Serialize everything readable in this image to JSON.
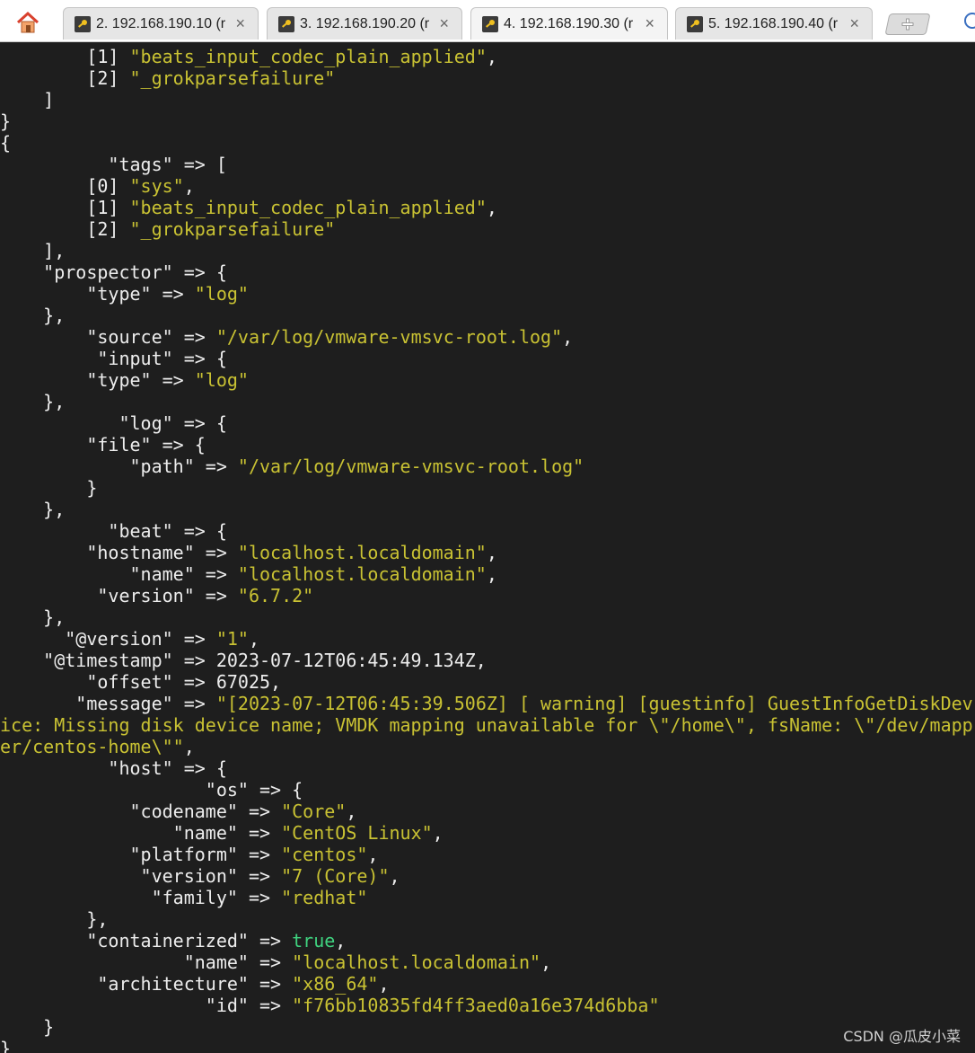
{
  "tabs": [
    {
      "label": "2. 192.168.190.10 (r",
      "active": false
    },
    {
      "label": "3. 192.168.190.20 (r",
      "active": false
    },
    {
      "label": "4. 192.168.190.30 (r",
      "active": true
    },
    {
      "label": "5. 192.168.190.40 (r",
      "active": false
    }
  ],
  "icons": {
    "home": "home-icon",
    "tab": "key-icon",
    "close": "close-icon",
    "new_tab": "new-tab-icon"
  },
  "colors": {
    "background": "#1e1e1e",
    "text": "#ededed",
    "string": "#c9c233",
    "boolean": "#3fd27f"
  },
  "terminal_lines": [
    [
      {
        "t": "        [1] "
      },
      {
        "t": "\"beats_input_codec_plain_applied\"",
        "c": "s"
      },
      {
        "t": ","
      }
    ],
    [
      {
        "t": "        [2] "
      },
      {
        "t": "\"_grokparsefailure\"",
        "c": "s"
      }
    ],
    [
      {
        "t": "    ]"
      }
    ],
    [
      {
        "t": "}"
      }
    ],
    [
      {
        "t": "{"
      }
    ],
    [
      {
        "t": "          \"tags\" => ["
      }
    ],
    [
      {
        "t": "        [0] "
      },
      {
        "t": "\"sys\"",
        "c": "s"
      },
      {
        "t": ","
      }
    ],
    [
      {
        "t": "        [1] "
      },
      {
        "t": "\"beats_input_codec_plain_applied\"",
        "c": "s"
      },
      {
        "t": ","
      }
    ],
    [
      {
        "t": "        [2] "
      },
      {
        "t": "\"_grokparsefailure\"",
        "c": "s"
      }
    ],
    [
      {
        "t": "    ],"
      }
    ],
    [
      {
        "t": "    \"prospector\" => {"
      }
    ],
    [
      {
        "t": "        \"type\" => "
      },
      {
        "t": "\"log\"",
        "c": "s"
      }
    ],
    [
      {
        "t": "    },"
      }
    ],
    [
      {
        "t": "        \"source\" => "
      },
      {
        "t": "\"/var/log/vmware-vmsvc-root.log\"",
        "c": "s"
      },
      {
        "t": ","
      }
    ],
    [
      {
        "t": "         \"input\" => {"
      }
    ],
    [
      {
        "t": "        \"type\" => "
      },
      {
        "t": "\"log\"",
        "c": "s"
      }
    ],
    [
      {
        "t": "    },"
      }
    ],
    [
      {
        "t": "           \"log\" => {"
      }
    ],
    [
      {
        "t": "        \"file\" => {"
      }
    ],
    [
      {
        "t": "            \"path\" => "
      },
      {
        "t": "\"/var/log/vmware-vmsvc-root.log\"",
        "c": "s"
      }
    ],
    [
      {
        "t": "        }"
      }
    ],
    [
      {
        "t": "    },"
      }
    ],
    [
      {
        "t": "          \"beat\" => {"
      }
    ],
    [
      {
        "t": "        \"hostname\" => "
      },
      {
        "t": "\"localhost.localdomain\"",
        "c": "s"
      },
      {
        "t": ","
      }
    ],
    [
      {
        "t": "            \"name\" => "
      },
      {
        "t": "\"localhost.localdomain\"",
        "c": "s"
      },
      {
        "t": ","
      }
    ],
    [
      {
        "t": "         \"version\" => "
      },
      {
        "t": "\"6.7.2\"",
        "c": "s"
      }
    ],
    [
      {
        "t": "    },"
      }
    ],
    [
      {
        "t": "      \"@version\" => "
      },
      {
        "t": "\"1\"",
        "c": "s"
      },
      {
        "t": ","
      }
    ],
    [
      {
        "t": "    \"@timestamp\" => 2023-07-12T06:45:49.134Z,"
      }
    ],
    [
      {
        "t": "        \"offset\" => 67025,"
      }
    ],
    [
      {
        "t": "       \"message\" => "
      },
      {
        "t": "\"[2023-07-12T06:45:39.506Z] [ warning] [guestinfo] GuestInfoGetDiskDev",
        "c": "s"
      }
    ],
    [
      {
        "t": "ice: Missing disk device name; VMDK mapping unavailable for \\\"/home\\\", fsName: \\\"/dev/mapp",
        "c": "s"
      }
    ],
    [
      {
        "t": "er/centos-home\\\"\"",
        "c": "s"
      },
      {
        "t": ","
      }
    ],
    [
      {
        "t": "          \"host\" => {"
      }
    ],
    [
      {
        "t": "                   \"os\" => {"
      }
    ],
    [
      {
        "t": "            \"codename\" => "
      },
      {
        "t": "\"Core\"",
        "c": "s"
      },
      {
        "t": ","
      }
    ],
    [
      {
        "t": "                \"name\" => "
      },
      {
        "t": "\"CentOS Linux\"",
        "c": "s"
      },
      {
        "t": ","
      }
    ],
    [
      {
        "t": "            \"platform\" => "
      },
      {
        "t": "\"centos\"",
        "c": "s"
      },
      {
        "t": ","
      }
    ],
    [
      {
        "t": "             \"version\" => "
      },
      {
        "t": "\"7 (Core)\"",
        "c": "s"
      },
      {
        "t": ","
      }
    ],
    [
      {
        "t": "              \"family\" => "
      },
      {
        "t": "\"redhat\"",
        "c": "s"
      }
    ],
    [
      {
        "t": "        },"
      }
    ],
    [
      {
        "t": "        \"containerized\" => "
      },
      {
        "t": "true",
        "c": "b"
      },
      {
        "t": ","
      }
    ],
    [
      {
        "t": "                 \"name\" => "
      },
      {
        "t": "\"localhost.localdomain\"",
        "c": "s"
      },
      {
        "t": ","
      }
    ],
    [
      {
        "t": "         \"architecture\" => "
      },
      {
        "t": "\"x86_64\"",
        "c": "s"
      },
      {
        "t": ","
      }
    ],
    [
      {
        "t": "                   \"id\" => "
      },
      {
        "t": "\"f76bb10835fd4ff3aed0a16e374d6bba\"",
        "c": "s"
      }
    ],
    [
      {
        "t": "    }"
      }
    ],
    [
      {
        "t": "}"
      }
    ]
  ],
  "watermark": "CSDN @瓜皮小菜"
}
